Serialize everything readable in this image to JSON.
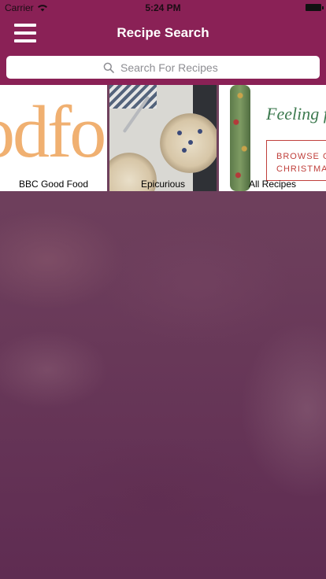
{
  "status_bar": {
    "carrier": "Carrier",
    "time": "5:24 PM"
  },
  "nav": {
    "title": "Recipe Search",
    "menu_icon": "hamburger-menu-icon"
  },
  "search": {
    "placeholder": "Search For Recipes",
    "icon": "search-icon"
  },
  "sources": [
    {
      "label": "BBC Good Food",
      "image_text": "odfo"
    },
    {
      "label": "Epicurious"
    },
    {
      "label": "All Recipes",
      "image_text": "Feeling f",
      "image_box_text": "BROWSE O\nCHRISTMAS"
    }
  ],
  "colors": {
    "brand": "#8a2156",
    "background": "#6c3d5b"
  }
}
